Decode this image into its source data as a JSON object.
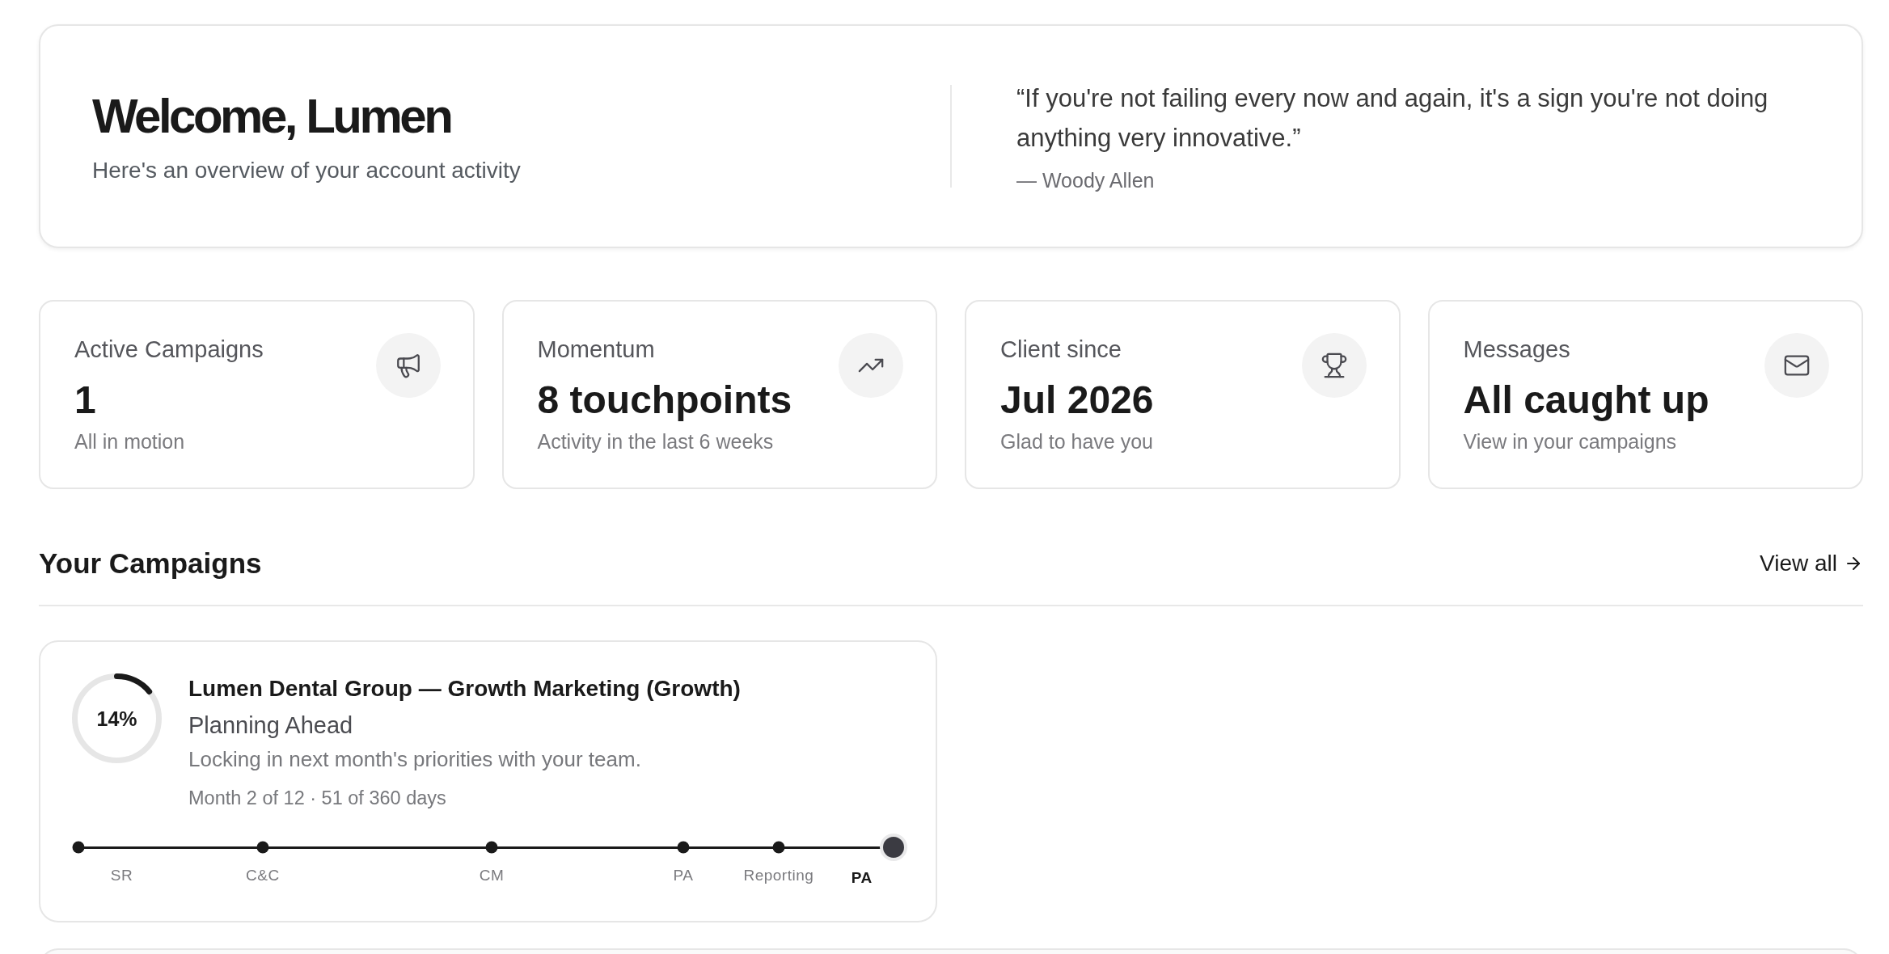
{
  "welcome": {
    "title": "Welcome, Lumen",
    "subtitle": "Here's an overview of your account activity",
    "quote": "“If you're not failing every now and again, it's a sign you're not doing anything very innovative.”",
    "author": "— Woody Allen"
  },
  "stats": [
    {
      "kind": "campaigns",
      "label": "Active Campaigns",
      "value": "1",
      "caption": "All in motion"
    },
    {
      "kind": "momentum",
      "label": "Momentum",
      "value": "8 touchpoints",
      "caption": "Activity in the last 6 weeks"
    },
    {
      "kind": "tenure",
      "label": "Client since",
      "value": "Jul 2026",
      "caption": "Glad to have you"
    },
    {
      "kind": "messages",
      "label": "Messages",
      "value": "All caught up",
      "caption": "View in your campaigns"
    }
  ],
  "campaigns_section": {
    "title": "Your Campaigns",
    "link": "View all"
  },
  "campaigns": [
    {
      "progress": {
        "level": 0.14,
        "label": "14%"
      },
      "title": "Lumen Dental Group — Growth Marketing (Growth)",
      "phase": "Planning Ahead",
      "description": "Locking in next month's priorities with your team.",
      "meta": "Month 2 of 12 · 51 of 360 days",
      "milestones": [
        {
          "label": "SR",
          "level": 0,
          "current": false
        },
        {
          "label": "C&C",
          "level": 0.226,
          "current": false
        },
        {
          "label": "CM",
          "level": 0.507,
          "current": false
        },
        {
          "label": "PA",
          "level": 0.742,
          "current": false
        },
        {
          "label": "Reporting",
          "level": 0.859,
          "current": false
        },
        {
          "label": "PA",
          "level": 1,
          "current": true
        }
      ]
    }
  ]
}
